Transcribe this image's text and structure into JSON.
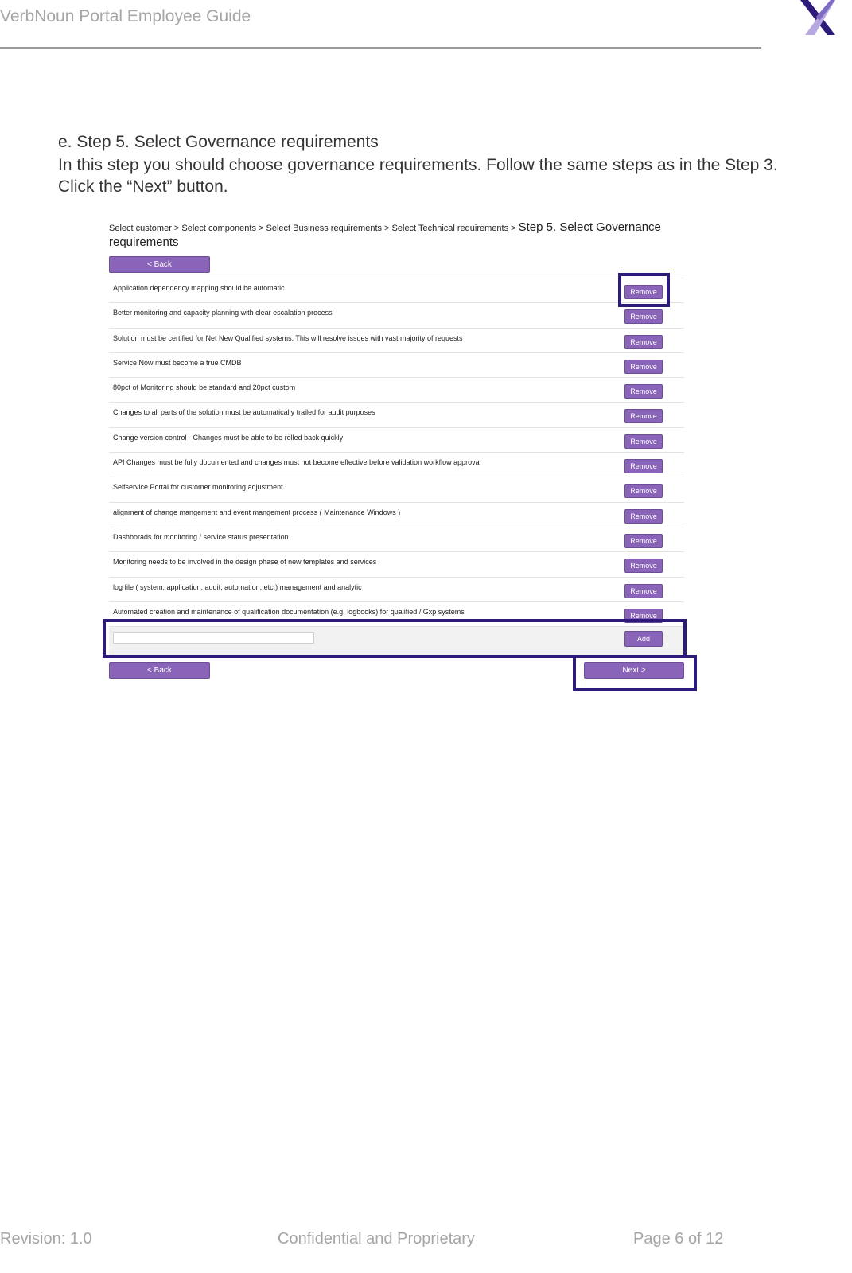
{
  "header": {
    "title": "VerbNoun Portal Employee Guide"
  },
  "colors": {
    "accent": "#8a64b8",
    "highlight_border": "#2e1a7a",
    "logo_dark": "#2e1a7a",
    "logo_light": "#b8a8e0"
  },
  "section": {
    "title": "e. Step 5. Select Governance requirements",
    "body_line1": "In this step you should choose governance requirements. Follow the same steps as in the Step 3.",
    "body_line2": "Click the “Next” button."
  },
  "screenshot": {
    "breadcrumb_prefix": "Select customer > Select components > Select Business requirements > Select Technical requirements > ",
    "breadcrumb_current_line1": "Step 5. Select Governance",
    "breadcrumb_current_line2": "requirements",
    "back_label": "< Back",
    "next_label": "Next >",
    "remove_label": "Remove",
    "add_label": "Add",
    "add_input_value": "",
    "requirements": [
      "Application dependency mapping should be automatic",
      "Better monitoring and capacity planning with clear escalation process",
      "Solution must be certified for Net New Qualified systems. This will resolve issues with vast majority of requests",
      "Service Now must become a true CMDB",
      "80pct of Monitoring should be standard and 20pct custom",
      "Changes to all parts of the solution must be automatically trailed for audit purposes",
      "Change version control - Changes must be able to be rolled back quickly",
      "API Changes must be fully documented and changes must not become effective before validation workflow approval",
      "Selfservice Portal for customer monitoring adjustment",
      "alignment of change mangement and event mangement process ( Maintenance Windows )",
      "Dashborads for monitoring / service status presentation",
      "Monitoring needs to be involved in the design phase of new templates and services",
      "log file ( system, application, audit, automation, etc.) management and analytic",
      "Automated creation and maintenance of qualification documentation (e.g. logbooks) for qualified / Gxp systems"
    ]
  },
  "footer": {
    "revision": "Revision:  1.0",
    "confidential": "Confidential and Proprietary",
    "page": "Page 6 of 12"
  }
}
